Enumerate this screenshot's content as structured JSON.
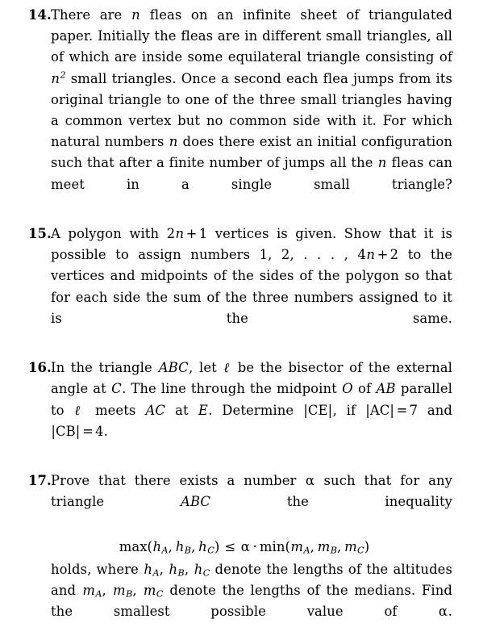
{
  "document": {
    "kind": "scanned-math-problem-page",
    "background_color": "#ffffff",
    "text_color": "#000000"
  },
  "problems": [
    {
      "number": "14.",
      "text_plain": "There are n fleas on an infinite sheet of triangulated paper. Initially the fleas are in different small triangles, all of which are inside some equilateral triangle consisting of n^2 small triangles. Once a second each flea jumps from its original triangle to one of the three small triangles having a common vertex but no common side with it. For which natural numbers n does there exist an initial configuration such that after a finite number of jumps all the n fleas can meet in a single small triangle?",
      "segments": [
        {
          "t": "text",
          "v": "There are "
        },
        {
          "t": "mi",
          "v": "n"
        },
        {
          "t": "text",
          "v": " fleas on an infinite sheet of triangulated paper. Initially the fleas are in different small triangles, all of which are inside some equilateral triangle consisting of "
        },
        {
          "t": "mi",
          "v": "n"
        },
        {
          "t": "sup",
          "v": "2"
        },
        {
          "t": "text",
          "v": " small triangles. Once a second each flea jumps from its original triangle to one of the three small triangles having a common vertex but no common side with it. For which natural numbers "
        },
        {
          "t": "mi",
          "v": "n"
        },
        {
          "t": "text",
          "v": " does there exist an initial configuration such that after a finite number of jumps all the "
        },
        {
          "t": "mi",
          "v": "n"
        },
        {
          "t": "text",
          "v": " fleas can meet in a single small triangle?"
        }
      ]
    },
    {
      "number": "15.",
      "text_plain": "A polygon with 2n + 1 vertices is given. Show that it is possible to assign numbers 1, 2, ..., 4n + 2 to the vertices and midpoints of the sides of the polygon so that for each side the sum of the three numbers assigned to it is the same.",
      "segments": [
        {
          "t": "text",
          "v": "A polygon with "
        },
        {
          "t": "mn",
          "v": "2"
        },
        {
          "t": "mi",
          "v": "n"
        },
        {
          "t": "mo",
          "v": "+"
        },
        {
          "t": "mn",
          "v": "1"
        },
        {
          "t": "text",
          "v": " vertices is given. Show that it is possible to assign numbers "
        },
        {
          "t": "mn",
          "v": "1, 2, . . . , 4"
        },
        {
          "t": "mi",
          "v": "n"
        },
        {
          "t": "mo",
          "v": "+"
        },
        {
          "t": "mn",
          "v": "2"
        },
        {
          "t": "text",
          "v": " to the vertices and midpoints of the sides of the polygon so that for each side the sum of the three numbers assigned to it is the same."
        }
      ]
    },
    {
      "number": "16.",
      "text_plain": "In the triangle ABC, let l be the bisector of the external angle at C. The line through the midpoint O of AB parallel to l meets AC at E. Determine |CE|, if |AC| = 7 and |CB| = 4.",
      "segments": [
        {
          "t": "text",
          "v": "In the triangle "
        },
        {
          "t": "mi",
          "v": "ABC"
        },
        {
          "t": "text",
          "v": ", let "
        },
        {
          "t": "script-l",
          "v": "ℓ"
        },
        {
          "t": "text",
          "v": " be the bisector of the external angle at "
        },
        {
          "t": "mi",
          "v": "C"
        },
        {
          "t": "text",
          "v": ". The line through the midpoint "
        },
        {
          "t": "mi",
          "v": "O"
        },
        {
          "t": "text",
          "v": " of "
        },
        {
          "t": "mi",
          "v": "AB"
        },
        {
          "t": "text",
          "v": " parallel to "
        },
        {
          "t": "script-l",
          "v": "ℓ"
        },
        {
          "t": "text",
          "v": " meets "
        },
        {
          "t": "mi",
          "v": "AC"
        },
        {
          "t": "text",
          "v": " at "
        },
        {
          "t": "mi",
          "v": "E"
        },
        {
          "t": "text",
          "v": ". Determine "
        },
        {
          "t": "abs",
          "v": "|CE|"
        },
        {
          "t": "text",
          "v": ", if "
        },
        {
          "t": "abs",
          "v": "|AC|"
        },
        {
          "t": "mo",
          "v": "="
        },
        {
          "t": "mn",
          "v": "7"
        },
        {
          "t": "text",
          "v": " and "
        },
        {
          "t": "abs",
          "v": "|CB|"
        },
        {
          "t": "mo",
          "v": "="
        },
        {
          "t": "mn",
          "v": "4"
        },
        {
          "t": "text",
          "v": "."
        }
      ]
    },
    {
      "number": "17.",
      "text_plain": "Prove that there exists a number a such that for any triangle ABC the inequality max(hA, hB, hC) <= a . min(mA, mB, mC) holds, where hA, hB, hC denote the lengths of the altitudes and mA, mB, mC denote the lengths of the medians. Find the smallest possible value of a.",
      "intro_segments": [
        {
          "t": "text",
          "v": "Prove that there exists a number "
        },
        {
          "t": "alpha",
          "v": "α"
        },
        {
          "t": "text",
          "v": " such that for any triangle "
        },
        {
          "t": "mi",
          "v": "ABC"
        },
        {
          "t": "text",
          "v": " the inequality"
        }
      ],
      "display_equation": {
        "lhs_fn": "max",
        "lhs_args": [
          {
            "base": "h",
            "sub": "A"
          },
          {
            "base": "h",
            "sub": "B"
          },
          {
            "base": "h",
            "sub": "C"
          }
        ],
        "relation": "≤",
        "coefficient": "α",
        "dot": "·",
        "rhs_fn": "min",
        "rhs_args": [
          {
            "base": "m",
            "sub": "A"
          },
          {
            "base": "m",
            "sub": "B"
          },
          {
            "base": "m",
            "sub": "C"
          }
        ],
        "open_paren": "(",
        "close_paren": ")",
        "comma": ",",
        "plain": "max(h_A, h_B, h_C) ≤ α · min(m_A, m_B, m_C)"
      },
      "outro_segments": [
        {
          "t": "text",
          "v": "holds, where "
        },
        {
          "t": "subvar",
          "base": "h",
          "sub": "A"
        },
        {
          "t": "text",
          "v": ", "
        },
        {
          "t": "subvar",
          "base": "h",
          "sub": "B"
        },
        {
          "t": "text",
          "v": ", "
        },
        {
          "t": "subvar",
          "base": "h",
          "sub": "C"
        },
        {
          "t": "text",
          "v": " denote the lengths of the altitudes and "
        },
        {
          "t": "subvar",
          "base": "m",
          "sub": "A"
        },
        {
          "t": "text",
          "v": ", "
        },
        {
          "t": "subvar",
          "base": "m",
          "sub": "B"
        },
        {
          "t": "text",
          "v": ", "
        },
        {
          "t": "subvar",
          "base": "m",
          "sub": "C"
        },
        {
          "t": "text",
          "v": " denote the lengths of the medians. Find the smallest possible value of "
        },
        {
          "t": "alpha",
          "v": "α"
        },
        {
          "t": "text",
          "v": "."
        }
      ]
    }
  ]
}
